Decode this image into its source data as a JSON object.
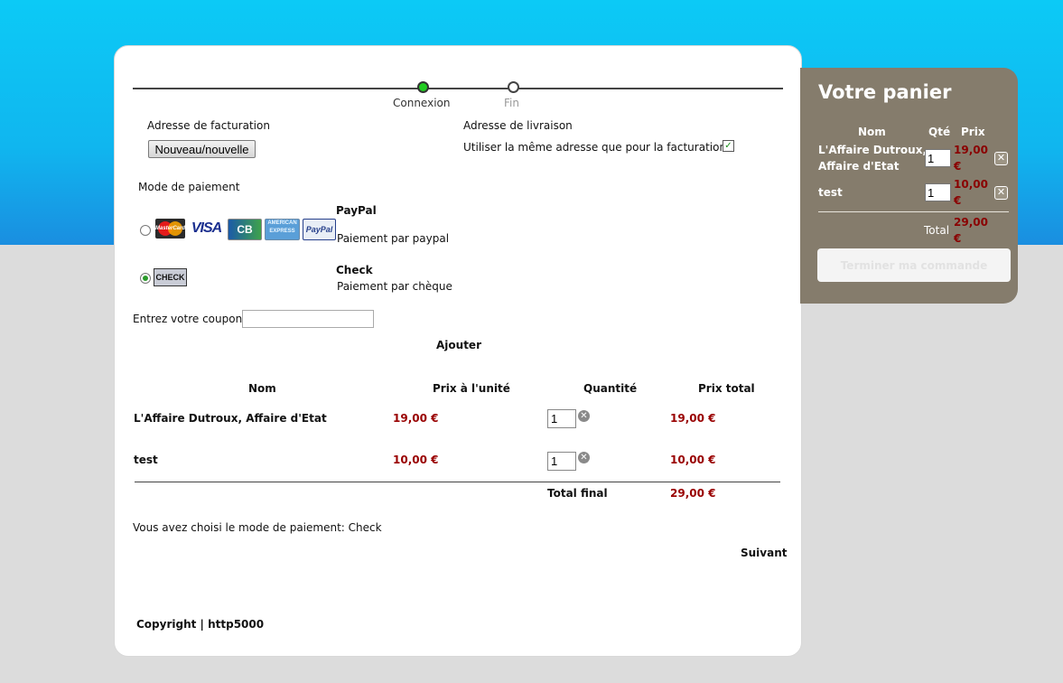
{
  "steps": [
    {
      "label": "Connexion",
      "active": true
    },
    {
      "label": "Fin",
      "active": false
    }
  ],
  "billing": {
    "label": "Adresse de facturation",
    "button": "Nouveau/nouvelle"
  },
  "shipping": {
    "label": "Adresse de livraison",
    "same_label": "Utiliser la même adresse que pour la facturation",
    "checked": true
  },
  "payment": {
    "label": "Mode de paiement",
    "options": [
      {
        "name": "PayPal",
        "desc": "Paiement par paypal",
        "selected": false,
        "logos": [
          "MasterCard",
          "VISA",
          "CB",
          "AMERICAN EXPRESS",
          "PayPal"
        ]
      },
      {
        "name": "Check",
        "desc": "Paiement par chèque",
        "selected": true,
        "logo": "CHECK"
      }
    ]
  },
  "coupon": {
    "label": "Entrez votre coupon",
    "value": "",
    "add": "Ajouter"
  },
  "table": {
    "headers": [
      "Nom",
      "Prix à l'unité",
      "Quantité",
      "Prix total"
    ],
    "rows": [
      {
        "name": "L'Affaire Dutroux, Affaire d'Etat",
        "unit": "19,00 €",
        "qty": "1",
        "total": "19,00 €"
      },
      {
        "name": "test",
        "unit": "10,00 €",
        "qty": "1",
        "total": "10,00 €"
      }
    ],
    "final_label": "Total final",
    "final_value": "29,00 €"
  },
  "chosen": "Vous avez choisi le mode de paiement: Check",
  "next": "Suivant",
  "footer": "Copyright | http5000",
  "cart": {
    "title": "Votre panier",
    "headers": [
      "Nom",
      "Qté",
      "Prix"
    ],
    "items": [
      {
        "name_line1": "L'Affaire Dutroux,",
        "name_line2": "Affaire d'Etat",
        "qty": "1",
        "price_line1": "19,00",
        "price_line2": "€"
      },
      {
        "name_line1": "test",
        "qty": "1",
        "price_line1": "10,00",
        "price_line2": "€"
      }
    ],
    "total_label": "Total",
    "total_line1": "29,00",
    "total_line2": "€",
    "finish": "Terminer ma commande"
  },
  "colors": {
    "accent_green": "#22cc22",
    "price_red": "#990000",
    "cart_bg": "#857c6c",
    "sky": "#10b6ef"
  }
}
